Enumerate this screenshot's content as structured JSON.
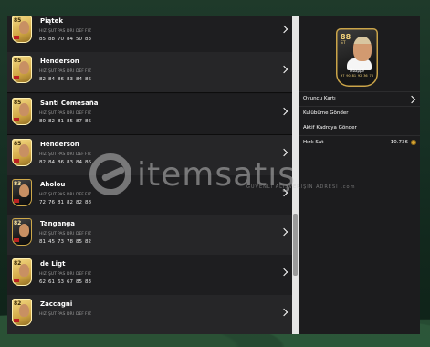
{
  "stat_labels": [
    "HIZ",
    "ŞUT",
    "PAS",
    "DRI",
    "DEF",
    "FIZ"
  ],
  "players": [
    {
      "name": "Piątek",
      "rating": "85",
      "stats": [
        "85",
        "88",
        "70",
        "84",
        "50",
        "83"
      ],
      "card": "gold"
    },
    {
      "name": "Henderson",
      "rating": "85",
      "stats": [
        "82",
        "84",
        "86",
        "83",
        "84",
        "86"
      ],
      "card": "gold"
    },
    {
      "name": "Santi Comesaña",
      "rating": "85",
      "stats": [
        "80",
        "82",
        "81",
        "85",
        "87",
        "86"
      ],
      "card": "gold"
    },
    {
      "name": "Henderson",
      "rating": "85",
      "stats": [
        "82",
        "84",
        "86",
        "83",
        "84",
        "86"
      ],
      "card": "gold"
    },
    {
      "name": "Aholou",
      "rating": "83",
      "stats": [
        "72",
        "76",
        "81",
        "82",
        "82",
        "88"
      ],
      "card": "black"
    },
    {
      "name": "Tanganga",
      "rating": "82",
      "stats": [
        "81",
        "45",
        "73",
        "78",
        "85",
        "82"
      ],
      "card": "black"
    },
    {
      "name": "de Ligt",
      "rating": "82",
      "stats": [
        "62",
        "61",
        "63",
        "67",
        "85",
        "83"
      ],
      "card": "gold"
    },
    {
      "name": "Zaccagni",
      "rating": "82",
      "stats": [],
      "card": "gold"
    }
  ],
  "detail": {
    "card_rating": "88",
    "card_position": "ST",
    "card_name": "Mbappé",
    "card_stats": [
      "97",
      "90",
      "81",
      "92",
      "36",
      "78"
    ],
    "menu": [
      {
        "label": "Oyuncu Kartı",
        "right": "",
        "has_chevron": true
      },
      {
        "label": "Kulübüme Gönder",
        "right": "",
        "has_chevron": false
      },
      {
        "label": "Aktif Kadroya Gönder",
        "right": "",
        "has_chevron": false
      },
      {
        "label": "Hızlı Sat",
        "right": "10.736",
        "has_coin": true
      }
    ]
  },
  "watermark": {
    "brand": "itemsatış",
    "sub": "GÜVENLİ ALIŞVERİŞİN ADRESİ .com"
  }
}
